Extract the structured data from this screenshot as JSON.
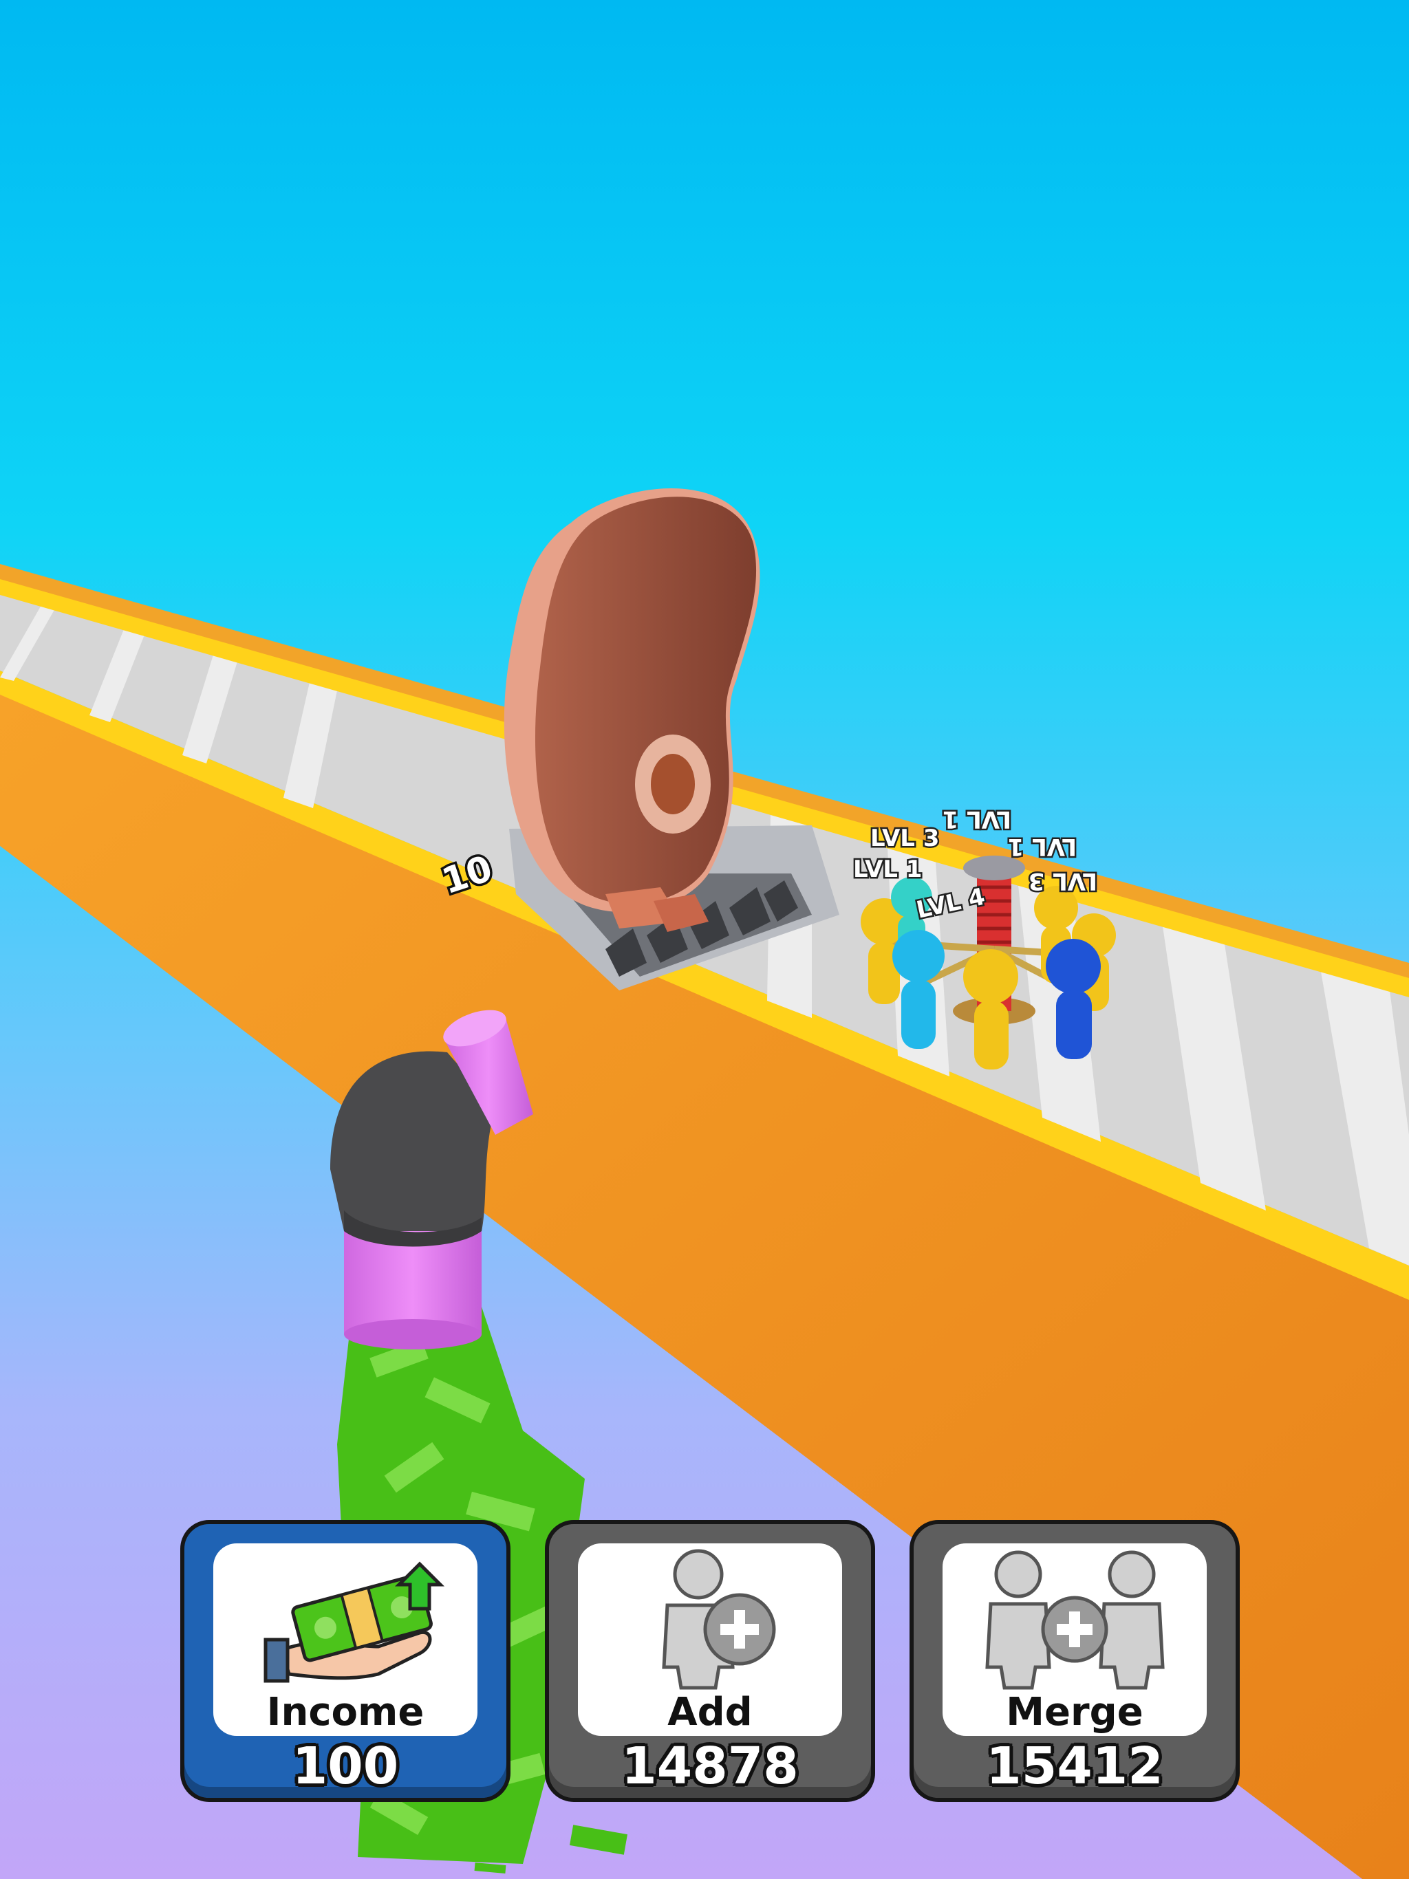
{
  "scene": {
    "floating_labels": [
      "LVL 3",
      "LVL 1",
      "LVL 4",
      "LVL 1",
      "LVL 1",
      "LVL 3"
    ],
    "floating_number": "10",
    "colors": {
      "sky_top": "#00b9f2",
      "sky_bottom": "#c2a6f8",
      "conveyor_orange": "#f28c1e",
      "conveyor_rail": "#ffd21a",
      "belt_gray": "#d0d0d0",
      "meat": "#8c4533",
      "pipe_pink": "#e27df0",
      "pipe_dark": "#4a4a4c",
      "cash_green": "#4cc41b"
    }
  },
  "upgrades": [
    {
      "label": "Income",
      "value": "100",
      "icon": "cash-hand-icon",
      "state": "active"
    },
    {
      "label": "Add",
      "value": "14878",
      "icon": "add-person-icon",
      "state": "inactive"
    },
    {
      "label": "Merge",
      "value": "15412",
      "icon": "merge-people-icon",
      "state": "inactive"
    }
  ]
}
